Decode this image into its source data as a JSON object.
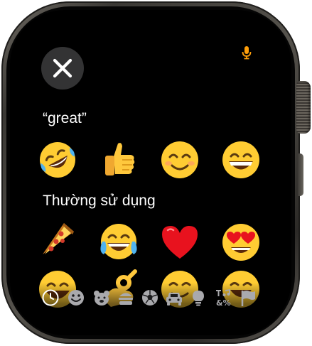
{
  "header": {
    "close_icon": "close-icon",
    "mic_icon": "microphone-icon"
  },
  "sections": [
    {
      "label": "“great”",
      "emojis": [
        "rolling-on-floor-laughing",
        "thumbs-up",
        "smiling-face",
        "grinning-face"
      ]
    },
    {
      "label": "Thường sử dụng",
      "emojis": [
        "pizza",
        "face-with-tears-of-joy",
        "red-heart",
        "heart-eyes"
      ]
    }
  ],
  "overflow_row": [
    "grinning-face-partial",
    "ok-hand-partial",
    "smiling-face-partial",
    "grinning-face-partial"
  ],
  "category_bar": [
    {
      "icon": "recent-clock-icon",
      "selected": true
    },
    {
      "icon": "smileys-icon"
    },
    {
      "icon": "animals-icon"
    },
    {
      "icon": "food-icon"
    },
    {
      "icon": "activity-ball-icon"
    },
    {
      "icon": "travel-car-icon"
    },
    {
      "icon": "objects-bulb-icon"
    },
    {
      "icon": "symbols-icon",
      "text": "T♪ &%"
    },
    {
      "icon": "flags-icon"
    }
  ],
  "colors": {
    "accent": "#ff9f0a",
    "emoji_yellow": "#ffcc33",
    "close_button_bg": "#333334"
  }
}
